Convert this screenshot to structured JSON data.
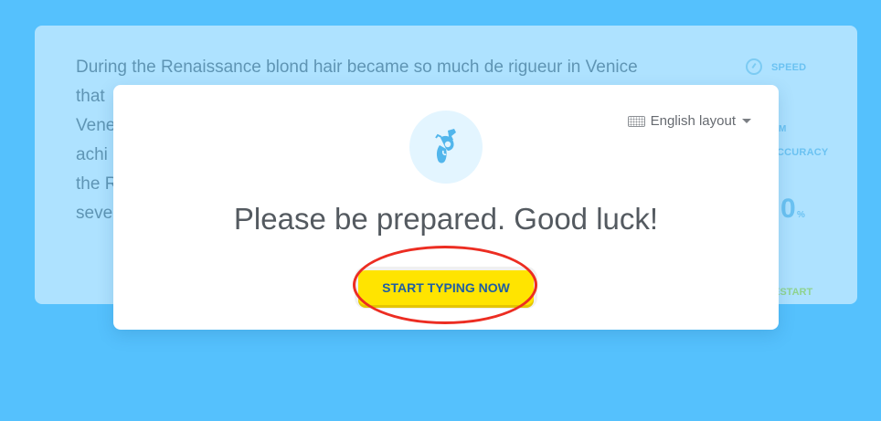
{
  "passage": {
    "lines": [
      "During the Renaissance blond hair became so much de rigueur in Venice",
      "that",
      "Vene",
      "achi",
      "the R",
      "seve"
    ]
  },
  "stats": {
    "speed_label": "SPEED",
    "speed_unit": "M",
    "accuracy_label": "CCURACY",
    "accuracy_value": "0",
    "accuracy_unit": "%",
    "restart_label": "ESTART"
  },
  "modal": {
    "layout_label": "English layout",
    "headline": "Please be prepared. Good luck!",
    "start_button": "START TYPING NOW",
    "icon": "revolver-icon"
  },
  "colors": {
    "page_background": "#55c1fd",
    "panel_background": "#aee2ff",
    "button_yellow": "#ffe400",
    "button_text": "#1f5ea3",
    "annotation_red": "#ec2d22"
  }
}
